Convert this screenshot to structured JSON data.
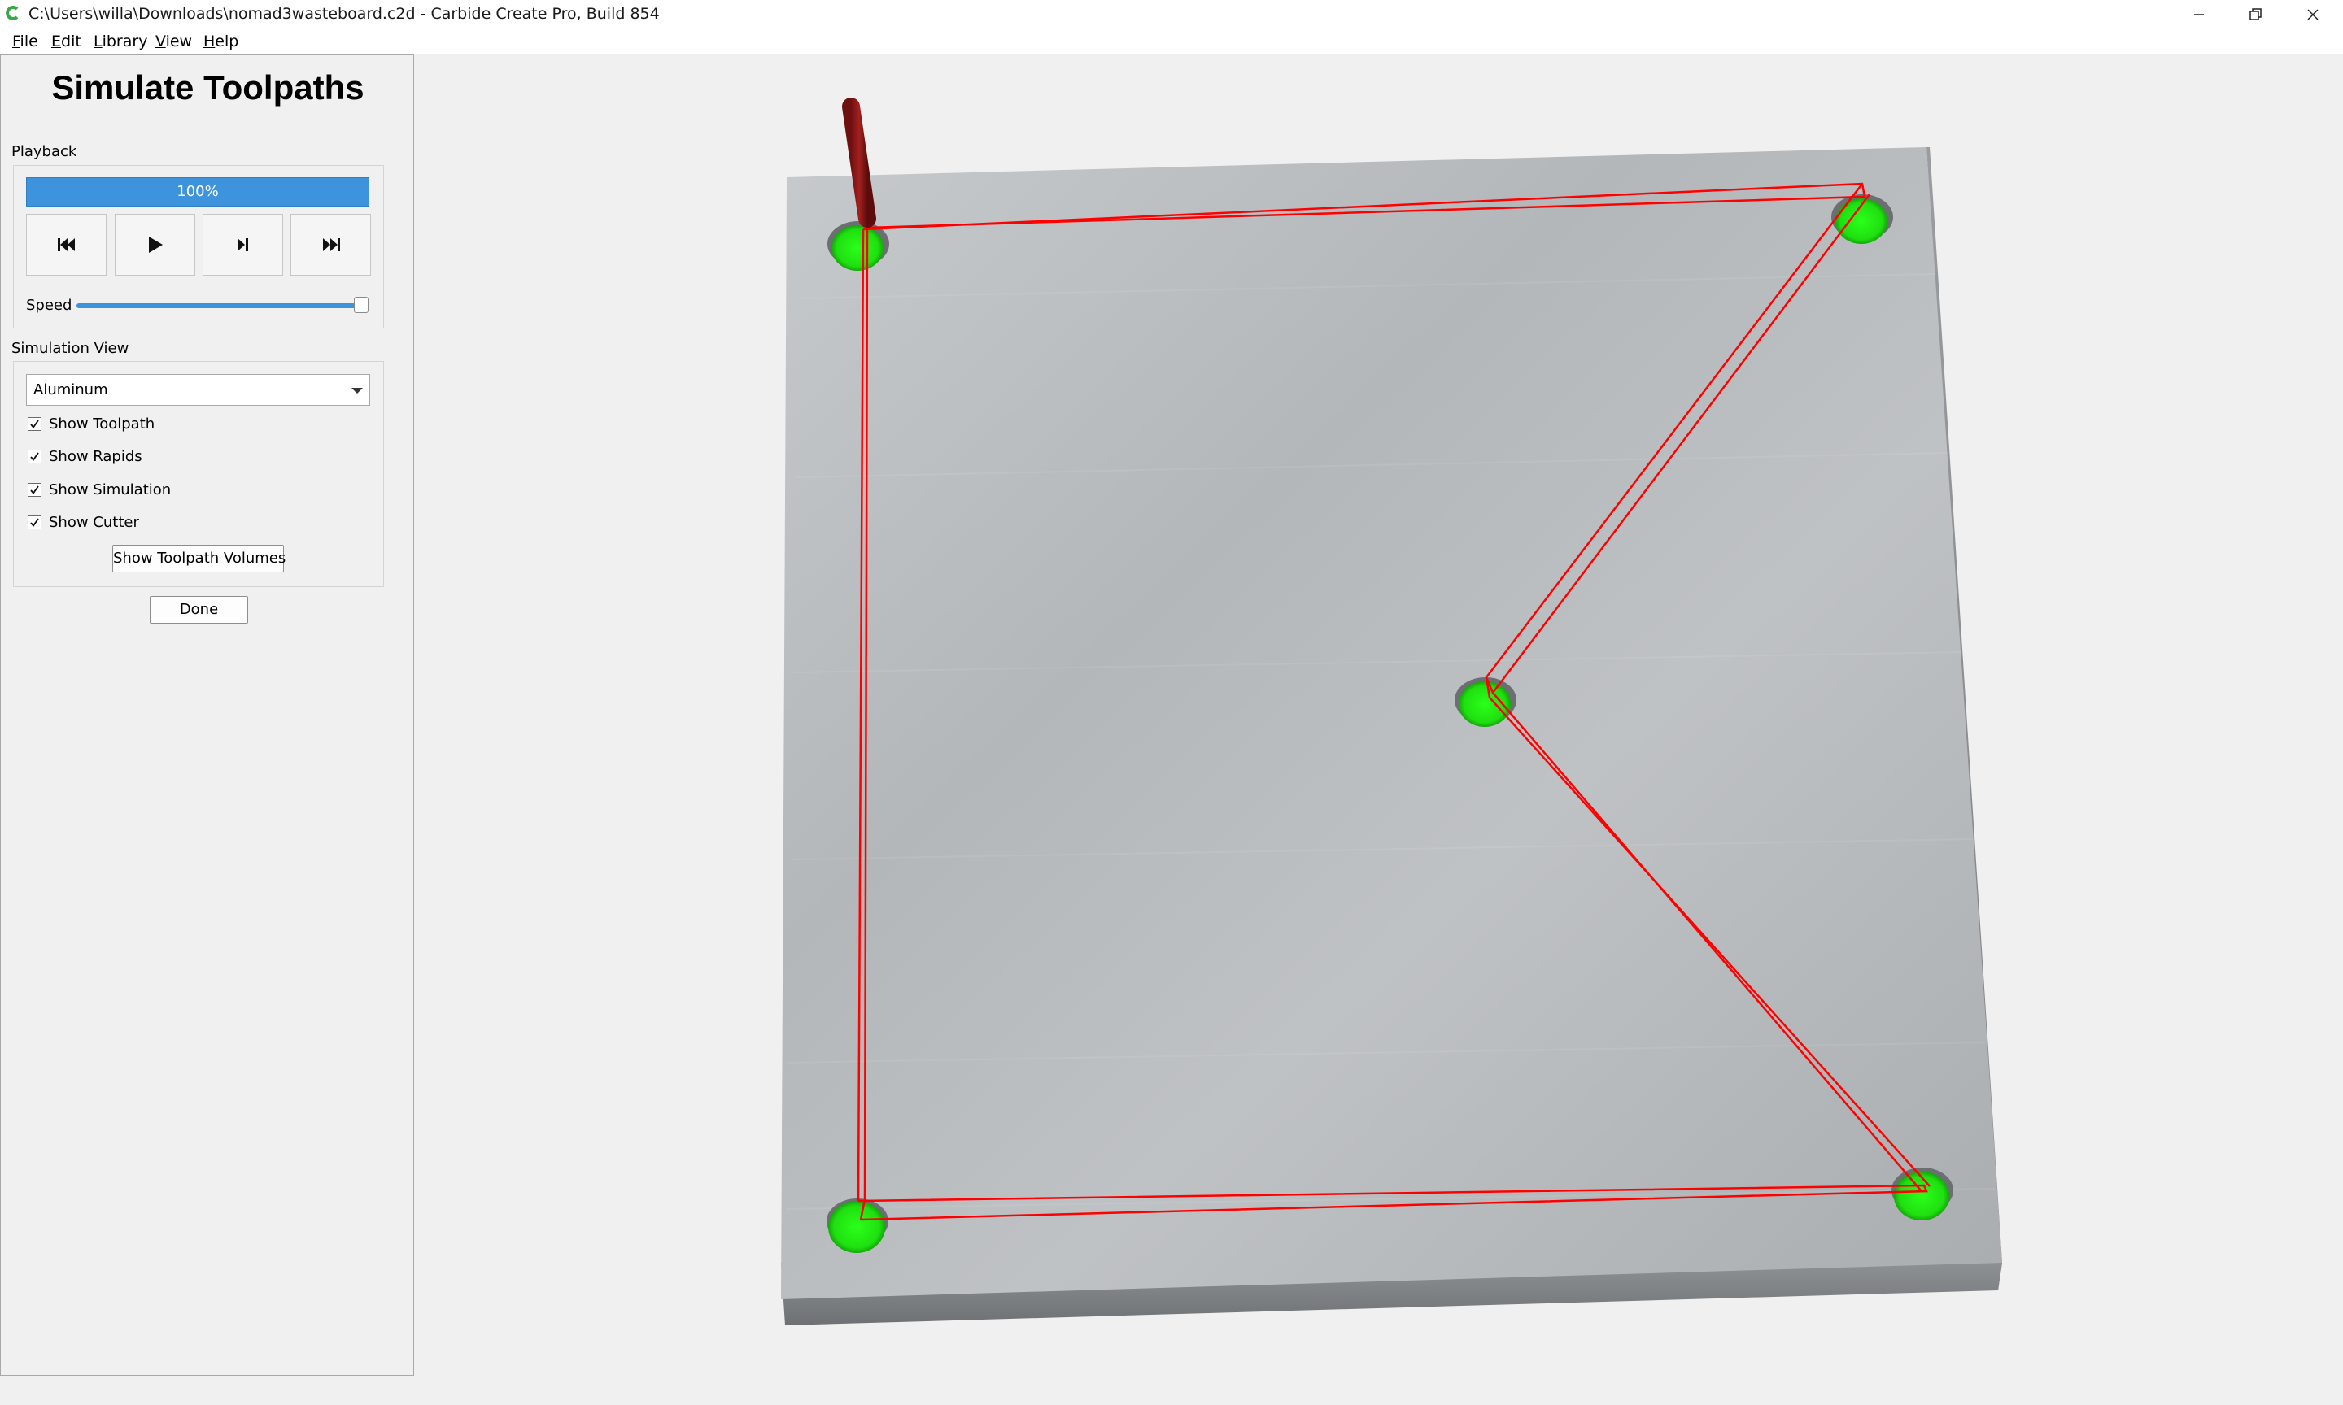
{
  "window": {
    "title": "C:\\Users\\willa\\Downloads\\nomad3wasteboard.c2d - Carbide Create Pro, Build 854"
  },
  "menu": [
    {
      "label": "File"
    },
    {
      "label": "Edit"
    },
    {
      "label": "Library"
    },
    {
      "label": "View"
    },
    {
      "label": "Help"
    }
  ],
  "panel": {
    "title": "Simulate Toolpaths",
    "playback": {
      "label": "Playback",
      "progress_text": "100%",
      "progress": 1.0,
      "speed_label": "Speed",
      "speed": 1.0,
      "buttons": [
        "rewind-to-start-icon",
        "play-icon",
        "step-forward-icon",
        "skip-to-end-icon"
      ]
    },
    "simulation_view": {
      "label": "Simulation View",
      "material_selected": "Aluminum",
      "options": [
        {
          "label": "Show Toolpath",
          "checked": true
        },
        {
          "label": "Show Rapids",
          "checked": true
        },
        {
          "label": "Show Simulation",
          "checked": true
        },
        {
          "label": "Show Cutter",
          "checked": true
        }
      ],
      "volumes_button": "Show Toolpath Volumes"
    },
    "done_button": "Done"
  },
  "colors": {
    "accent": "#3d93dc",
    "toolpath": "#ff0000",
    "hole": "#22ee11",
    "stock": "#b8bcbf",
    "cutter": "#8b1a1a"
  }
}
